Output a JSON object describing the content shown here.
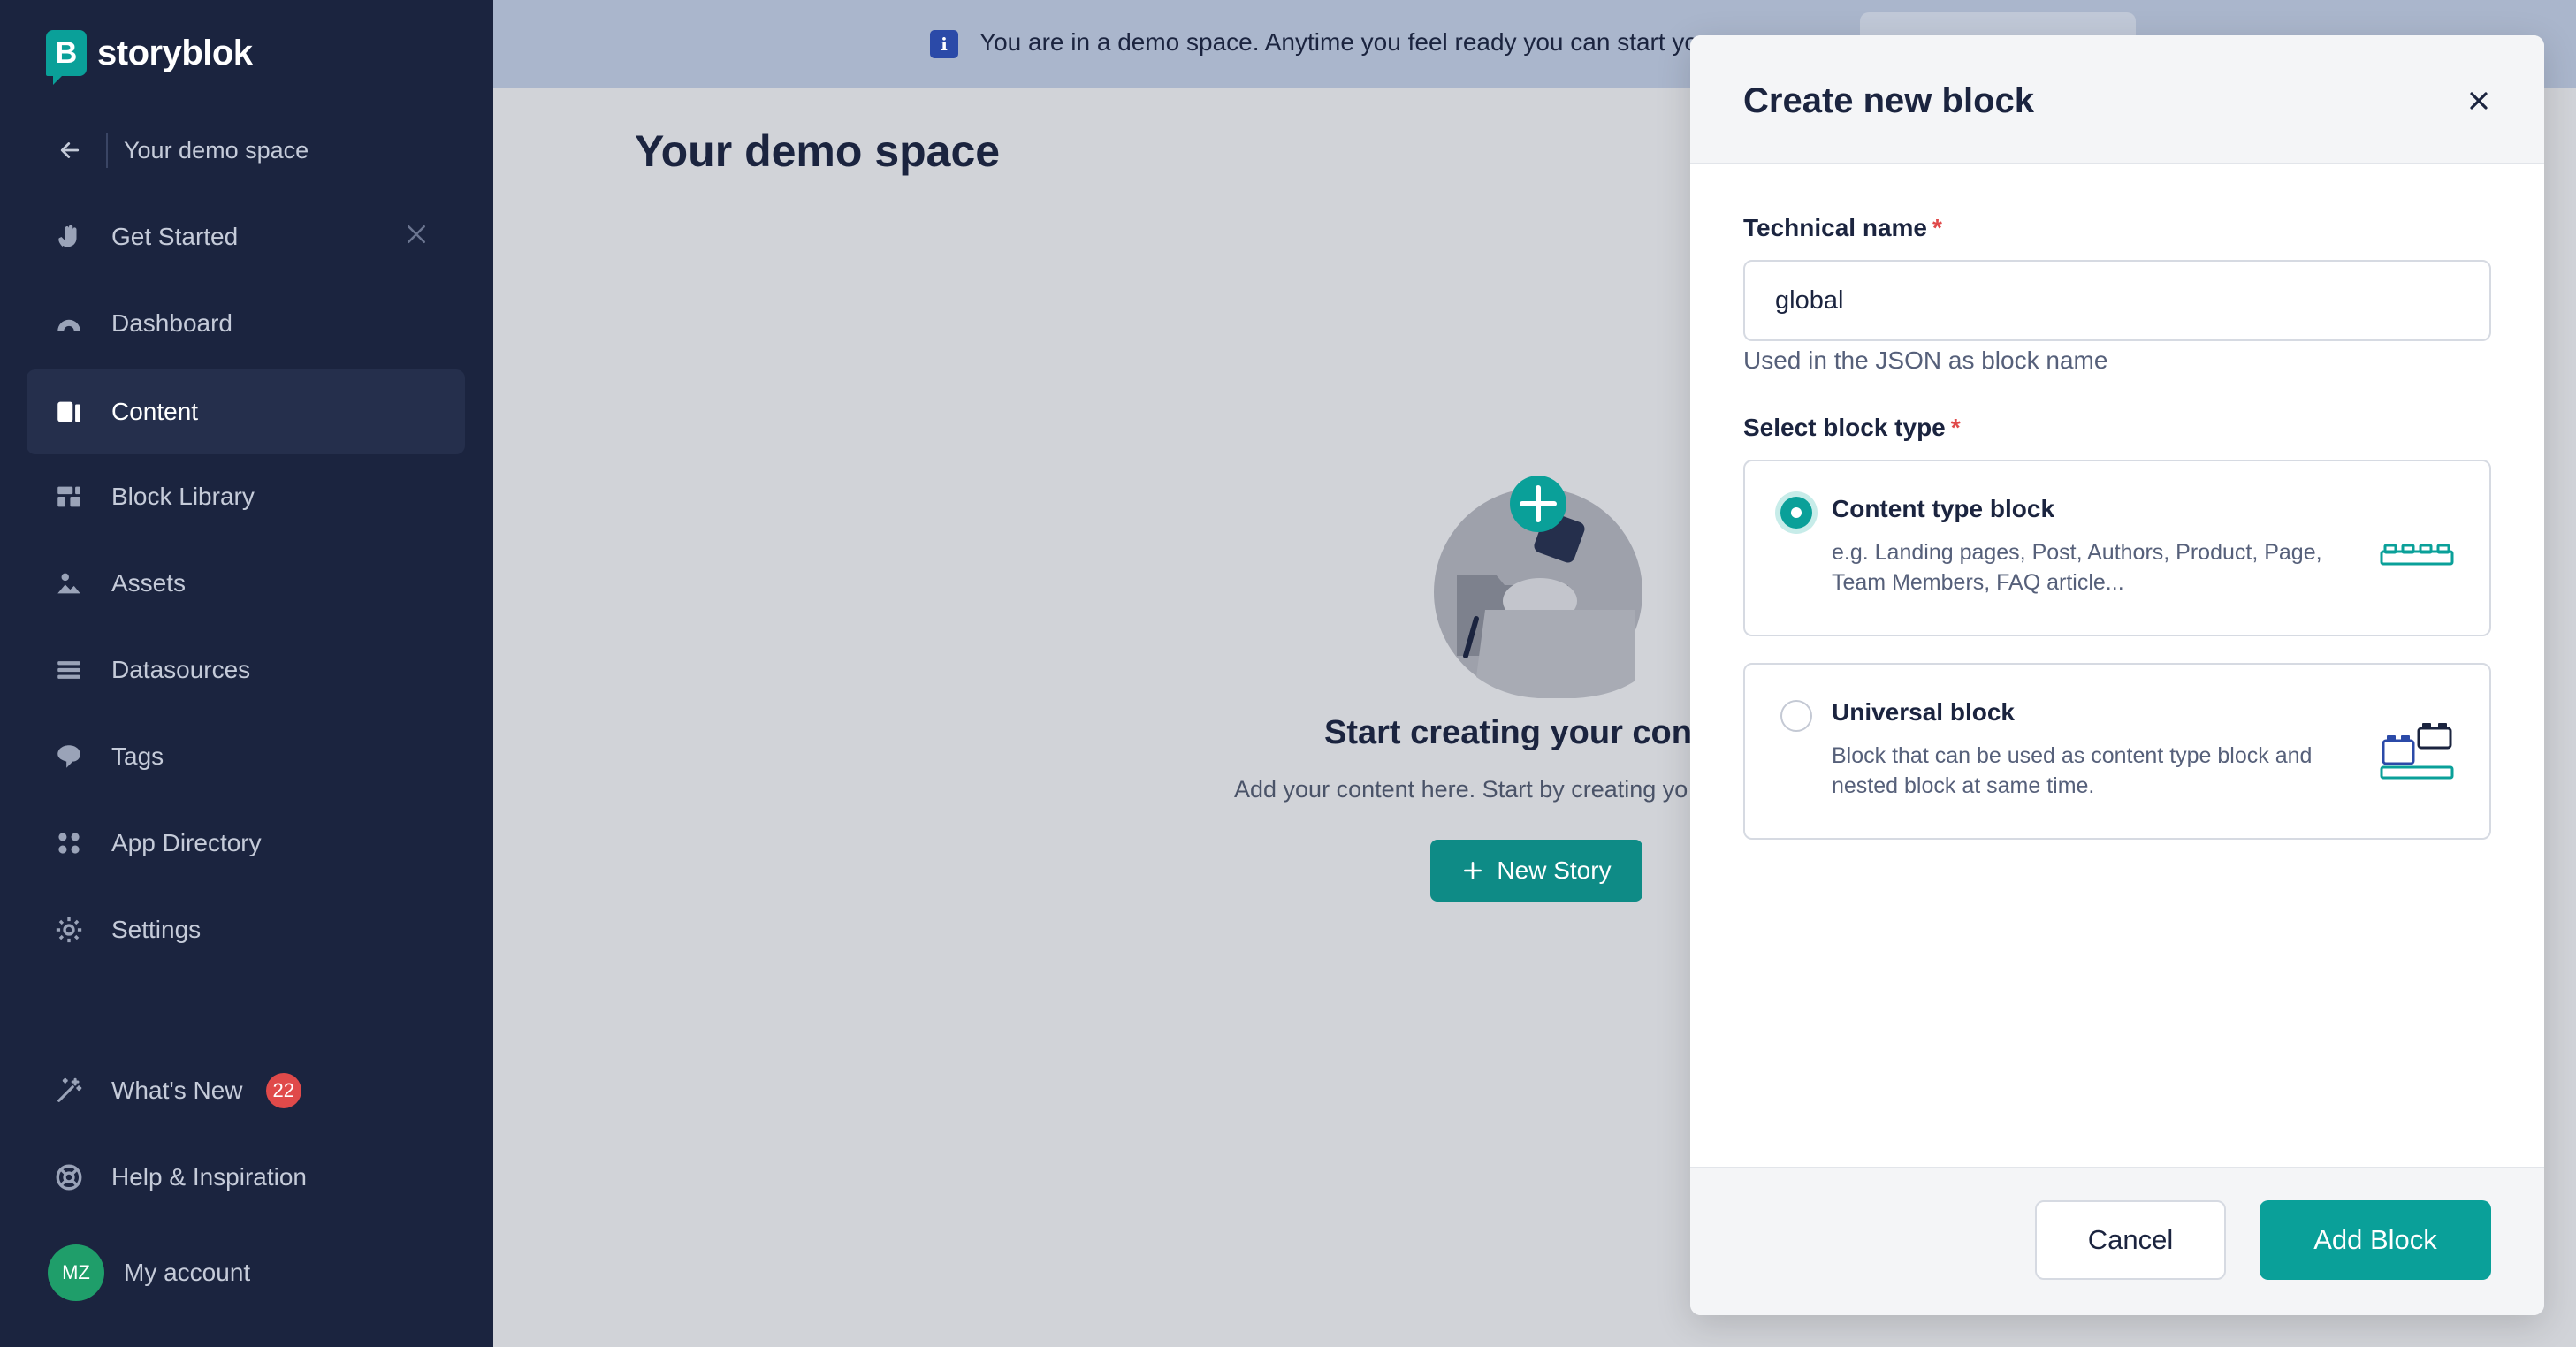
{
  "sidebar": {
    "logo_mark": "B",
    "logo_text": "storyblok",
    "back_label": "Your demo space",
    "items": [
      {
        "label": "Get Started",
        "icon": "hand-wave-icon"
      },
      {
        "label": "Dashboard",
        "icon": "gauge-icon"
      },
      {
        "label": "Content",
        "icon": "content-icon",
        "active": true
      },
      {
        "label": "Block Library",
        "icon": "blocks-icon"
      },
      {
        "label": "Assets",
        "icon": "image-icon"
      },
      {
        "label": "Datasources",
        "icon": "list-icon"
      },
      {
        "label": "Tags",
        "icon": "tag-icon"
      },
      {
        "label": "App Directory",
        "icon": "grid-dots-icon"
      },
      {
        "label": "Settings",
        "icon": "gear-icon"
      }
    ],
    "whats_new": {
      "label": "What's New",
      "badge": "22"
    },
    "help": {
      "label": "Help & Inspiration"
    },
    "account": {
      "initials": "MZ",
      "label": "My account"
    }
  },
  "banner": {
    "info_glyph": "i",
    "text": "You are in a demo space. Anytime you feel ready you can start yo"
  },
  "main": {
    "title": "Your demo space",
    "empty_title": "Start creating your cont",
    "empty_subtitle": "Add your content here. Start by creating yo",
    "new_story_label": "New Story"
  },
  "modal": {
    "title": "Create new block",
    "technical_name_label": "Technical name",
    "required_marker": "*",
    "technical_name_value": "global",
    "technical_name_help": "Used in the JSON as block name",
    "block_type_label": "Select block type",
    "options": [
      {
        "title": "Content type block",
        "description": "e.g. Landing pages, Post, Authors, Product, Page, Team Members, FAQ article...",
        "selected": true
      },
      {
        "title": "Universal block",
        "description": "Block that can be used as content type block and nested block at same time.",
        "selected": false
      }
    ],
    "cancel_label": "Cancel",
    "add_label": "Add Block"
  },
  "colors": {
    "sidebar_bg": "#1b243f",
    "accent": "#0aa099",
    "badge": "#e04a4a",
    "banner_bg": "#aab6cc"
  }
}
